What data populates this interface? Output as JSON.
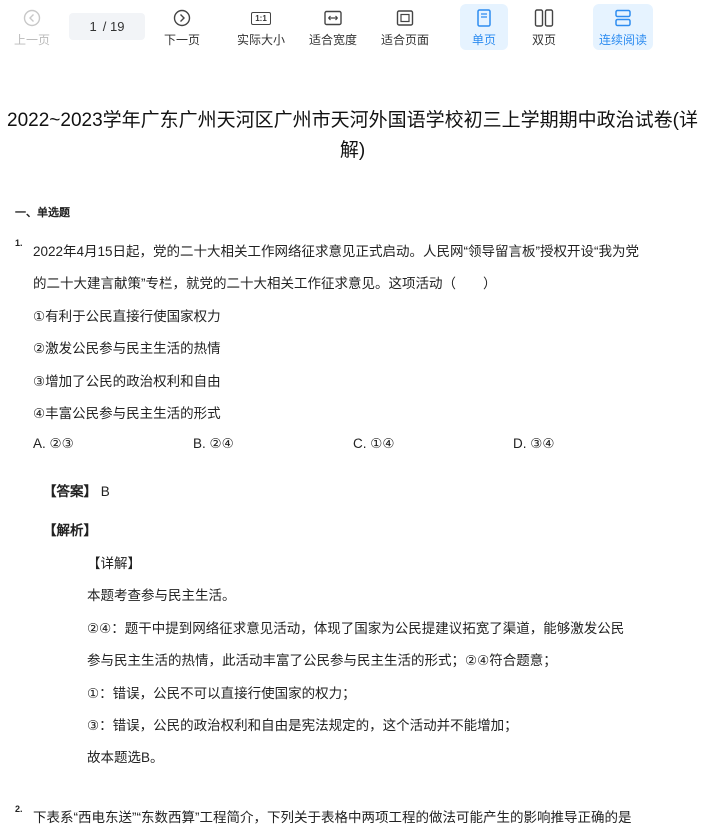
{
  "toolbar": {
    "prev_label": "上一页",
    "page_current": "1",
    "page_total": "/ 19",
    "next_label": "下一页",
    "actual_size_label": "实际大小",
    "actual_size_icon_text": "1:1",
    "fit_width_label": "适合宽度",
    "fit_page_label": "适合页面",
    "single_page_label": "单页",
    "double_page_label": "双页",
    "continuous_label": "连续阅读",
    "accent_color": "#2d8cf0"
  },
  "document": {
    "title_line1": "2022~2023学年广东广州天河区广州市天河外国语学校初三上学期期中政治试卷(详",
    "title_line2": "解)",
    "section_heading": "一、单选题",
    "q1": {
      "number": "1.",
      "stem_line1": "2022年4月15日起，党的二十大相关工作网络征求意见正式启动。人民网“领导留言板”授权开设“我为党",
      "stem_line2": "的二十大建言献策”专栏，就党的二十大相关工作征求意见。这项活动（　　）",
      "statements": [
        "①有利于公民直接行使国家权力",
        "②激发公民参与民主生活的热情",
        "③增加了公民的政治权利和自由",
        "④丰富公民参与民主生活的形式"
      ],
      "choices": [
        "A. ②③",
        "B. ②④",
        "C. ①④",
        "D. ③④"
      ],
      "answer_label": "【答案】",
      "answer_value": "B",
      "analysis_label": "【解析】",
      "detail_label": "【详解】",
      "explanation": [
        "本题考查参与民主生活。",
        "②④：题干中提到网络征求意见活动，体现了国家为公民提建议拓宽了渠道，能够激发公民",
        "参与民主生活的热情，此活动丰富了公民参与民主生活的形式；②④符合题意；",
        "①：错误，公民不可以直接行使国家的权力；",
        "③：错误，公民的政治权利和自由是宪法规定的，这个活动并不能增加；",
        "故本题选B。"
      ]
    },
    "q2": {
      "number": "2.",
      "stem_line1": "下表系“西电东送”“东数西算”工程简介，下列关于表格中两项工程的做法可能产生的影响推导正确的是"
    }
  }
}
